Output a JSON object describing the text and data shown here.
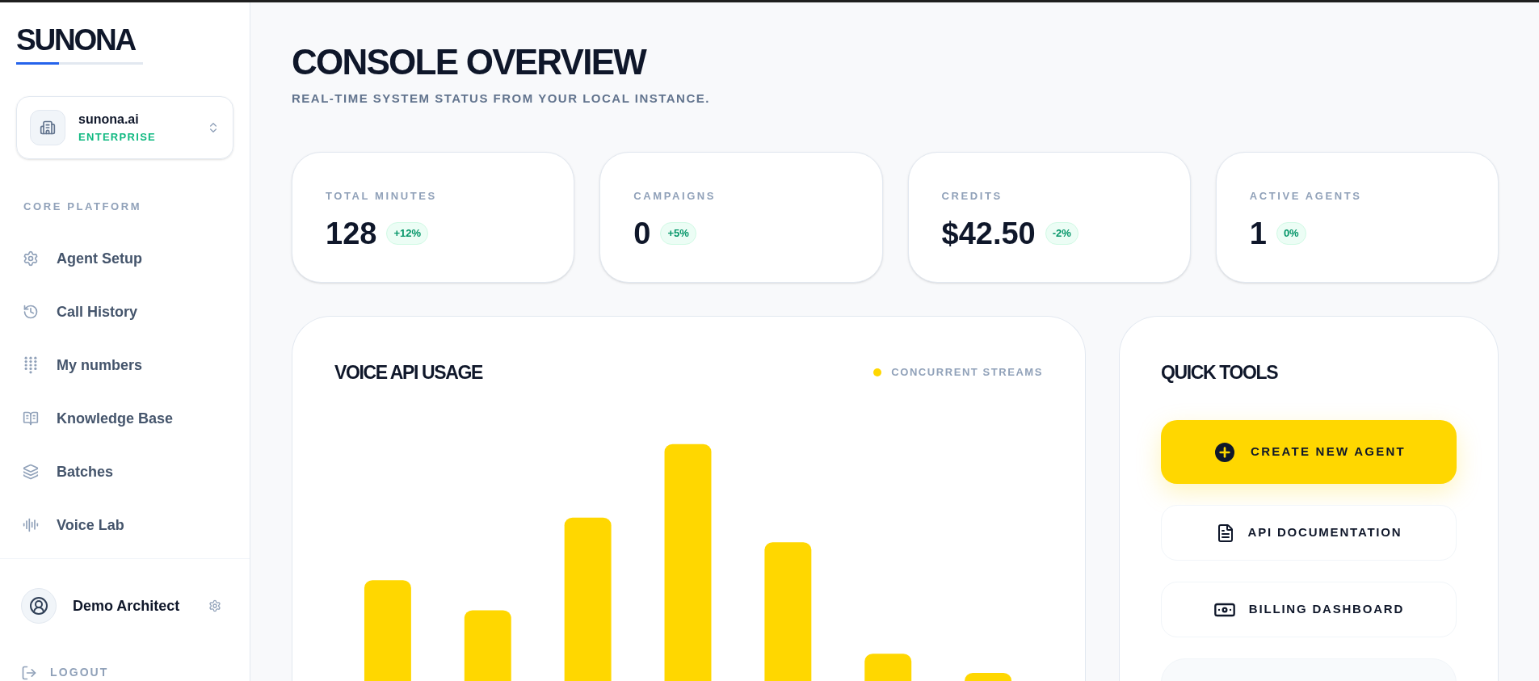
{
  "sidebar": {
    "logo": "SUNONA",
    "org": {
      "name": "sunona.ai",
      "plan": "ENTERPRISE"
    },
    "section_label": "CORE PLATFORM",
    "items": [
      {
        "label": "Agent Setup"
      },
      {
        "label": "Call History"
      },
      {
        "label": "My numbers"
      },
      {
        "label": "Knowledge Base"
      },
      {
        "label": "Batches"
      },
      {
        "label": "Voice Lab"
      }
    ],
    "user": {
      "name": "Demo Architect"
    },
    "logout": "LOGOUT"
  },
  "header": {
    "title": "CONSOLE OVERVIEW",
    "subtitle": "REAL-TIME SYSTEM STATUS FROM YOUR LOCAL INSTANCE."
  },
  "stats": [
    {
      "label": "TOTAL MINUTES",
      "value": "128",
      "change": "+12%"
    },
    {
      "label": "CAMPAIGNS",
      "value": "0",
      "change": "+5%"
    },
    {
      "label": "CREDITS",
      "value": "$42.50",
      "change": "-2%"
    },
    {
      "label": "ACTIVE AGENTS",
      "value": "1",
      "change": "0%"
    }
  ],
  "usage": {
    "title": "VOICE API USAGE",
    "legend": "CONCURRENT STREAMS"
  },
  "quick_tools": {
    "title": "QUICK TOOLS",
    "buttons": [
      {
        "label": "CREATE NEW AGENT",
        "kind": "primary"
      },
      {
        "label": "API DOCUMENTATION",
        "kind": "docs"
      },
      {
        "label": "BILLING DASHBOARD",
        "kind": "billing"
      }
    ]
  }
}
